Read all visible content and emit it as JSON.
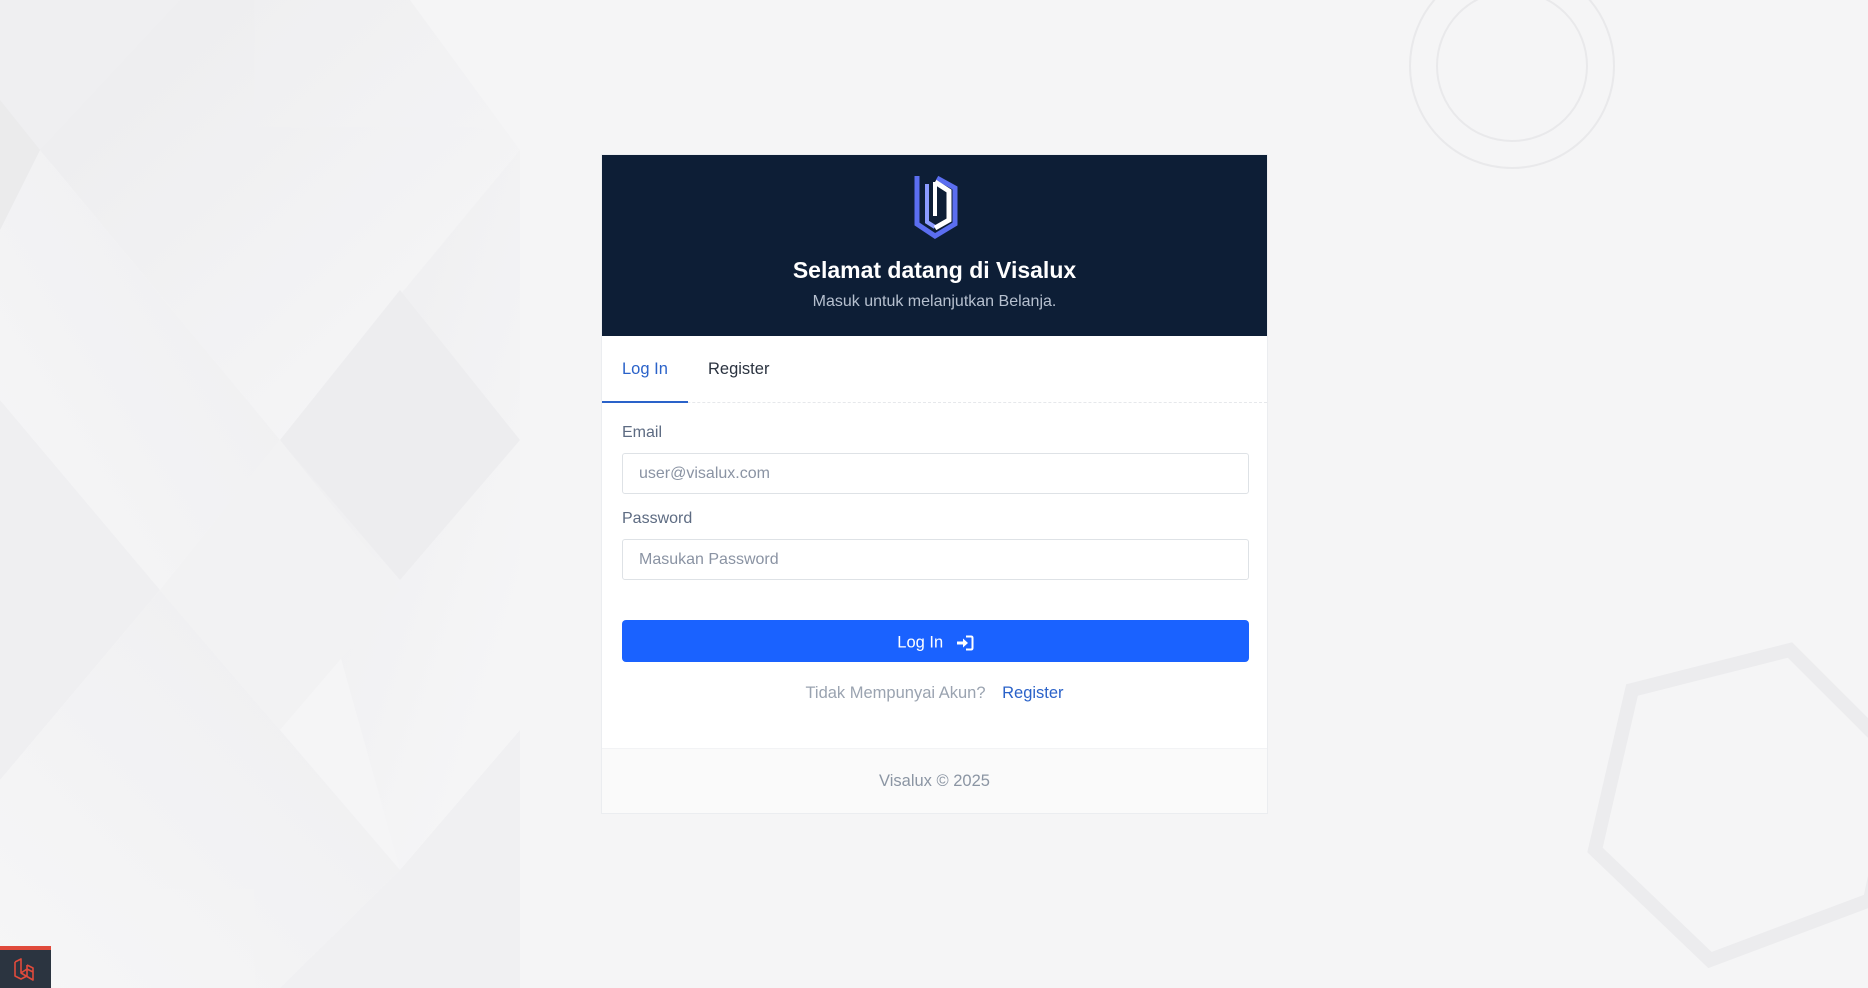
{
  "header": {
    "logo_icon": "visalux-shield-logo",
    "title": "Selamat datang di Visalux",
    "subtitle": "Masuk untuk melanjutkan Belanja."
  },
  "tabs": [
    {
      "label": "Log In",
      "active": true
    },
    {
      "label": "Register",
      "active": false
    }
  ],
  "form": {
    "email_label": "Email",
    "email_placeholder": "user@visalux.com",
    "email_value": "",
    "password_label": "Password",
    "password_placeholder": "Masukan Password",
    "password_value": "",
    "submit_label": "Log In",
    "submit_icon": "sign-in-icon"
  },
  "register_prompt": {
    "text": "Tidak Mempunyai Akun?",
    "link_label": "Register"
  },
  "footer": {
    "text": "Visalux © 2025"
  },
  "corner_badge": {
    "icon": "laravel-logo-icon"
  },
  "colors": {
    "header_bg": "#0d1e36",
    "primary": "#1a62ff",
    "tab_active": "#2a62c9",
    "page_bg": "#f5f5f6",
    "badge_accent": "#e04a3b"
  }
}
